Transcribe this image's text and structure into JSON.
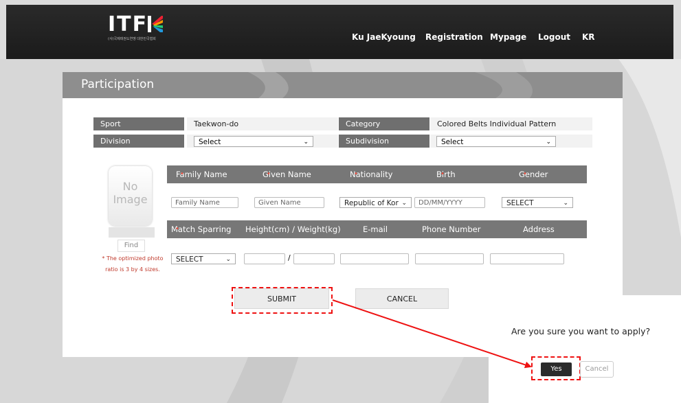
{
  "header": {
    "logo_text": "ITF",
    "logo_subtitle": "(사)국제태권도연맹 대한민국협회",
    "nav": [
      "Ku JaeKyoung",
      "Registration",
      "Mypage",
      "Logout",
      "KR"
    ]
  },
  "panel": {
    "title": "Participation"
  },
  "info": {
    "sport_label": "Sport",
    "sport_value": "Taekwon-do",
    "category_label": "Category",
    "category_value": "Colored Belts Individual Pattern",
    "division_label": "Division",
    "division_value": "Select",
    "subdivision_label": "Subdivision",
    "subdivision_value": "Select"
  },
  "photo": {
    "placeholder_line1": "No",
    "placeholder_line2": "Image",
    "find_label": "Find",
    "note": "* The optimized photo ratio is 3 by 4 sizes."
  },
  "row1_headers": [
    "Family Name",
    "Given Name",
    "Nationality",
    "Birth",
    "Gender"
  ],
  "row1_inputs": {
    "family_placeholder": "Family Name",
    "given_placeholder": "Given Name",
    "nationality_value": "Republic of Kor",
    "birth_placeholder": "DD/MM/YYYY",
    "gender_value": "SELECT"
  },
  "row2_headers": [
    "Match Sparring",
    "Height(cm) / Weight(kg)",
    "E-mail",
    "Phone Number",
    "Address"
  ],
  "row2_inputs": {
    "sparring_value": "SELECT",
    "slash": "/"
  },
  "buttons": {
    "submit": "SUBMIT",
    "cancel": "CANCEL"
  },
  "dialog": {
    "question": "Are you sure you want to apply?",
    "yes": "Yes",
    "cancel": "Cancel"
  },
  "colors": {
    "annotation_red": "#e11111",
    "header_dark": "#1b1b1b",
    "label_gray": "#6f6f6f"
  }
}
